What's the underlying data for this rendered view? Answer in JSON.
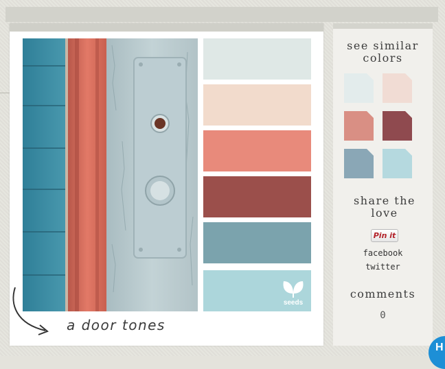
{
  "post": {
    "caption": "a door tones",
    "palette": [
      {
        "name": "pale-gray-blue",
        "hex": "#dfe8e6"
      },
      {
        "name": "blush",
        "hex": "#f2dbcc"
      },
      {
        "name": "coral",
        "hex": "#e88a7b"
      },
      {
        "name": "brick",
        "hex": "#9b4f4b"
      },
      {
        "name": "slate-teal",
        "hex": "#7ba3ad"
      },
      {
        "name": "aqua",
        "hex": "#acd6db"
      }
    ],
    "logo_text": "seeds"
  },
  "sidebar": {
    "similar_heading": "see similar colors",
    "similar_colors": [
      "#e3ecec",
      "#f1dcd4",
      "#d98f84",
      "#8f4a4f",
      "#8aa7b6",
      "#b5d9df"
    ],
    "share_heading": "share the love",
    "pinit_label": "Pin it",
    "facebook_label": "facebook",
    "twitter_label": "twitter",
    "comments_heading": "comments",
    "comments_count": "0"
  },
  "corner_badge": "H"
}
